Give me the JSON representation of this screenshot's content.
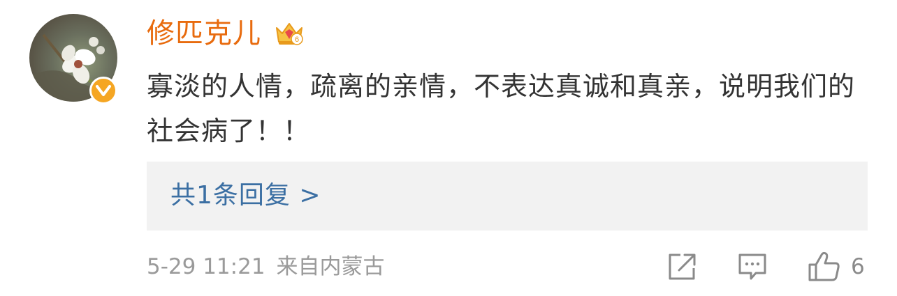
{
  "user": {
    "name": "修匹克儿",
    "badge_level": "6"
  },
  "comment": {
    "text": "寡淡的人情，疏离的亲情，不表达真诚和真亲，说明我们的社会病了！！"
  },
  "replies": {
    "label": "共1条回复 >"
  },
  "meta": {
    "time": "5-29 11:21",
    "source": "来自内蒙古"
  },
  "actions": {
    "like_count": "6"
  },
  "colors": {
    "username": "#e86b0e",
    "reply_link": "#3b6fa3",
    "verified_badge": "#f5a623",
    "text": "#333333",
    "meta": "#9a9a9a"
  }
}
